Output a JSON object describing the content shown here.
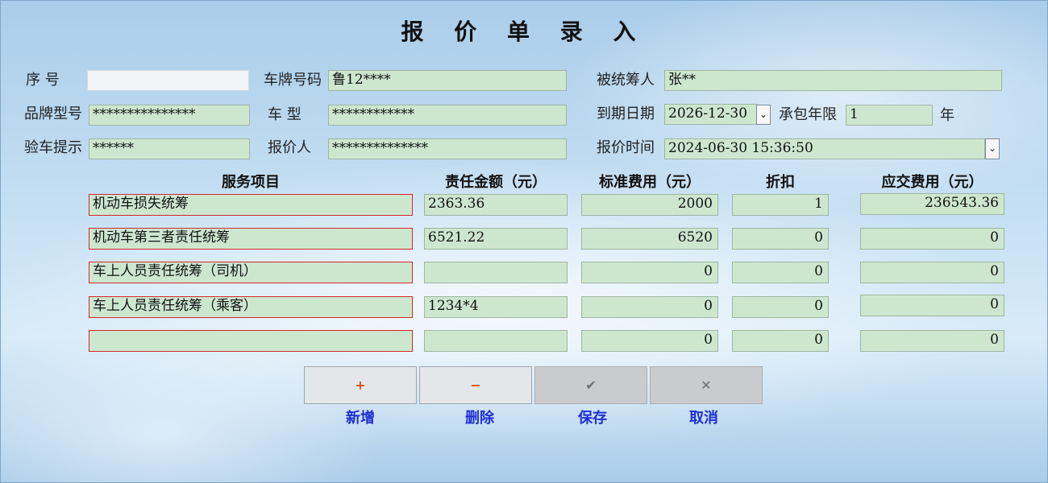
{
  "title": "报 价 单 录 入",
  "form": {
    "serial_label": "序  号",
    "serial_value": "",
    "plate_label": "车牌号码",
    "plate_value": "鲁12****",
    "insured_label": "被统筹人",
    "insured_value": "张**",
    "brand_label": "品牌型号",
    "brand_value": "***************",
    "cartype_label": "车    型",
    "cartype_value": "************",
    "expire_label": "到期日期",
    "expire_value": "2026-12-30",
    "term_label": "承包年限",
    "term_value": "1",
    "term_unit": "年",
    "inspect_label": "验车提示",
    "inspect_value": "******",
    "quoter_label": "报价人",
    "quoter_value": "**************",
    "quote_time_label": "报价时间",
    "quote_time_value": "2024-06-30 15:36:50",
    "dropdown_glyph": "⌄"
  },
  "table": {
    "headers": [
      "服务项目",
      "责任金额（元）",
      "标准费用（元）",
      "折扣",
      "应交费用（元）"
    ],
    "rows": [
      [
        "机动车损失统筹",
        "2363.36",
        "2000",
        "1",
        "236543.36"
      ],
      [
        "机动车第三者责任统筹",
        "6521.22",
        "6520",
        "0",
        "0"
      ],
      [
        "车上人员责任统筹（司机）",
        "",
        "0",
        "0",
        "0"
      ],
      [
        "车上人员责任统筹（乘客）",
        "1234*4",
        "0",
        "0",
        "0"
      ],
      [
        "",
        "",
        "0",
        "0",
        "0"
      ]
    ]
  },
  "buttons": {
    "add_icon": "+",
    "add_label": "新增",
    "delete_icon": "−",
    "delete_label": "删除",
    "save_icon": "✔",
    "save_label": "保存",
    "cancel_icon": "✕",
    "cancel_label": "取消"
  },
  "colors": {
    "field_bg": "#cde7cf",
    "button_label": "#1d2fd6",
    "required_border": "#d7262c"
  }
}
